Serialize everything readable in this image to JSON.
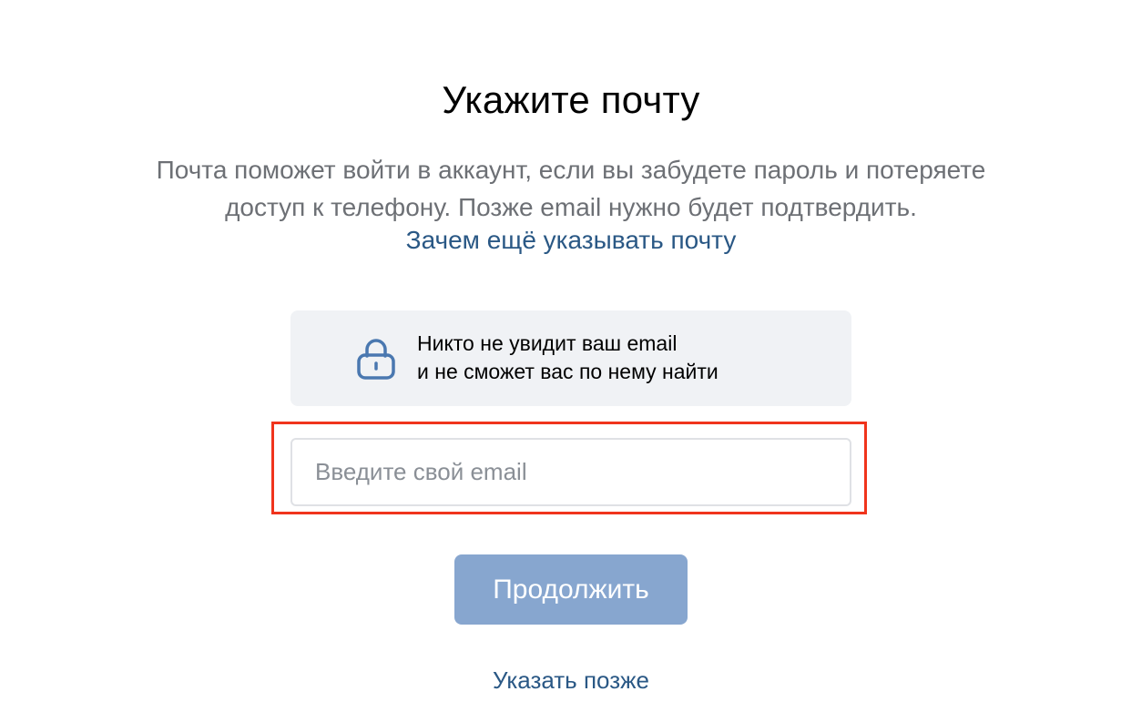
{
  "header": {
    "title": "Укажите почту"
  },
  "description": {
    "line1": "Почта поможет войти в аккаунт, если вы забудете пароль и потеряете",
    "line2": "доступ к телефону. Позже email нужно будет подтвердить."
  },
  "why_link": "Зачем ещё указывать почту",
  "privacy_notice": {
    "icon": "lock-icon",
    "line1": "Никто не увидит ваш email",
    "line2": "и не сможет вас по нему найти"
  },
  "email_field": {
    "value": "",
    "placeholder": "Введите свой email"
  },
  "continue_button": {
    "label": "Продолжить",
    "state": "disabled"
  },
  "later_link": "Указать позже",
  "colors": {
    "link": "#2a5885",
    "button_bg": "#87a6cf",
    "notice_bg": "#f0f2f5",
    "highlight": "#f0341c"
  }
}
